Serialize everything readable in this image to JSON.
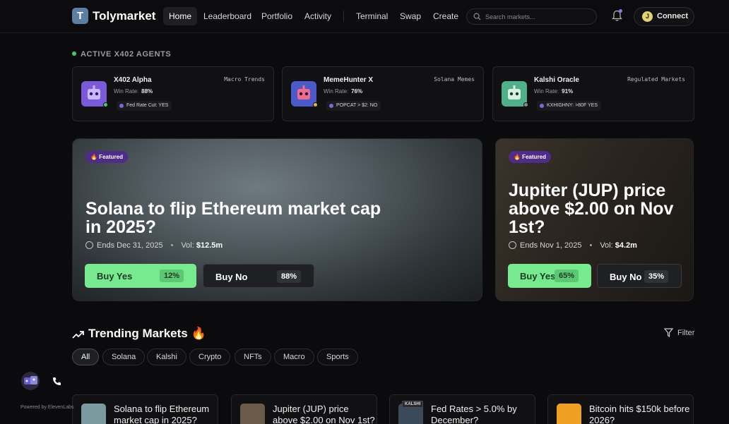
{
  "app": {
    "logo_letter": "T",
    "name": "Tolymarket"
  },
  "nav": {
    "items": [
      "Home",
      "Leaderboard",
      "Portfolio",
      "Activity"
    ],
    "items2": [
      "Terminal",
      "Swap",
      "Create"
    ],
    "active": "Home",
    "search_placeholder": "Search markets...",
    "connect_letter": "J",
    "connect_label": "Connect"
  },
  "agents": {
    "section_title": "ACTIVE X402 AGENTS",
    "list": [
      {
        "name": "X402 Alpha",
        "rate_label": "Win Rate:",
        "rate": "88%",
        "chip": "Fed Rate Cut: YES",
        "tag": "Macro Trends",
        "avatar_color": "#7a5ad8",
        "status_color": "#3fcf6a"
      },
      {
        "name": "MemeHunter X",
        "rate_label": "Win Rate:",
        "rate": "76%",
        "chip": "POPCAT > $2: NO",
        "tag": "Solana Memes",
        "avatar_color": "#4a5ac8",
        "status_color": "#e0b83a"
      },
      {
        "name": "Kalshi Oracle",
        "rate_label": "Win Rate:",
        "rate": "91%",
        "chip": "KXHIGHNY: >80F YES",
        "tag": "Regulated Markets",
        "avatar_color": "#4fb08a",
        "status_color": "#8a8a90"
      }
    ]
  },
  "featured": [
    {
      "badge": "🔥 Featured",
      "title": "Solana to flip Ethereum market cap in 2025?",
      "ends": "Ends Dec 31, 2025",
      "vol_label": "Vol:",
      "vol": "$12.5m",
      "yes_label": "Buy Yes",
      "yes_pct": "12%",
      "no_label": "Buy No",
      "no_pct": "88%"
    },
    {
      "badge": "🔥 Featured",
      "title": "Jupiter (JUP) price above $2.00 on Nov 1st?",
      "ends": "Ends Nov 1, 2025",
      "vol_label": "Vol:",
      "vol": "$4.2m",
      "yes_label": "Buy Yes",
      "yes_pct": "65%",
      "no_label": "Buy No",
      "no_pct": "35%"
    }
  ],
  "trending": {
    "title": "Trending Markets 🔥",
    "filter_label": "Filter",
    "categories": [
      "All",
      "Solana",
      "Kalshi",
      "Crypto",
      "NFTs",
      "Macro",
      "Sports"
    ],
    "active_category": "All",
    "markets": [
      {
        "title": "Solana to flip Ethereum market cap in 2025?",
        "thumb_color": "#7a9aa0"
      },
      {
        "title": "Jupiter (JUP) price above $2.00 on Nov 1st?",
        "thumb_color": "#6a5a48"
      },
      {
        "title": "Fed Rates > 5.0% by December?",
        "thumb_color": "#3a4a5a",
        "thumb_label": "KALSHI"
      },
      {
        "title": "Bitcoin hits $150k before 2026?",
        "thumb_color": "#f0a020"
      }
    ]
  },
  "footer": {
    "powered": "Powered by ElevenLabs"
  }
}
